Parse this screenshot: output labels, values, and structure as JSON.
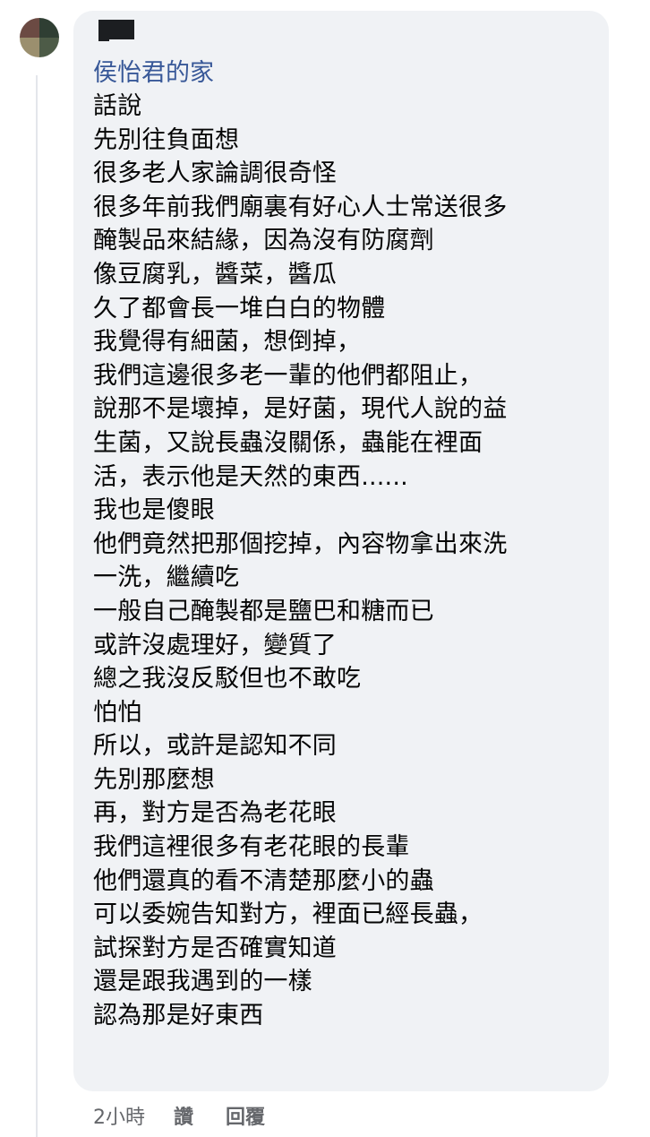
{
  "comment": {
    "author": "侯怡君的家",
    "lines": [
      "話說",
      "先別往負面想",
      "很多老人家論調很奇怪",
      "很多年前我們廟裏有好心人士常送很多",
      "醃製品來結緣，因為沒有防腐劑",
      "像豆腐乳，醬菜，醬瓜",
      "久了都會長一堆白白的物體",
      "我覺得有細菌，想倒掉，",
      "我們這邊很多老一輩的他們都阻止，",
      "說那不是壞掉，是好菌，現代人說的益",
      "生菌，又說長蟲沒關係，蟲能在裡面",
      "活，表示他是天然的東西......",
      "我也是傻眼",
      "他們竟然把那個挖掉，內容物拿出來洗",
      "一洗，繼續吃",
      "一般自己醃製都是鹽巴和糖而已",
      "或許沒處理好，變質了",
      "總之我沒反駁但也不敢吃",
      "怕怕",
      "所以，或許是認知不同",
      "先別那麼想",
      "再，對方是否為老花眼",
      "我們這裡很多有老花眼的長輩",
      "他們還真的看不清楚那麼小的蟲",
      "可以委婉告知對方，裡面已經長蟲，",
      "試探對方是否確實知道",
      "還是跟我遇到的一樣",
      "認為那是好東西"
    ]
  },
  "meta": {
    "time": "2小時",
    "like_label": "讚",
    "reply_label": "回覆"
  },
  "colors": {
    "bubble": "#f0f2f5",
    "author": "#385898",
    "text": "#050505",
    "meta": "#65676b"
  }
}
